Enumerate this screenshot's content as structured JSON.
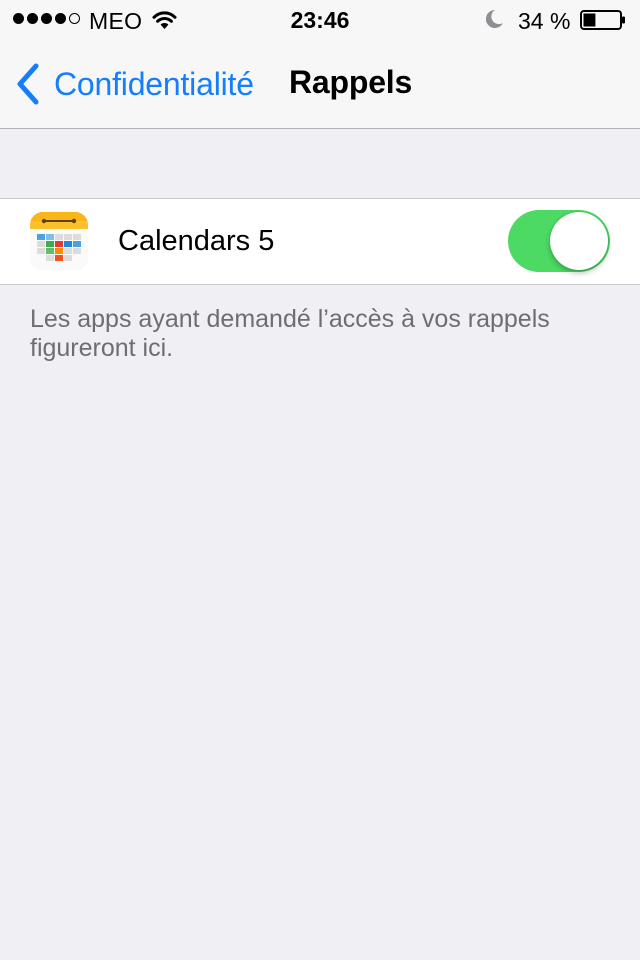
{
  "status_bar": {
    "signal_bars_filled": 4,
    "signal_bars_total": 5,
    "carrier": "MEO",
    "time": "23:46",
    "battery_percent_label": "34 %",
    "battery_level": 0.34,
    "icons": [
      "signal-dots",
      "wifi-icon",
      "moon-icon",
      "battery-icon"
    ]
  },
  "nav": {
    "back_label": "Confidentialité",
    "title": "Rappels",
    "accent_color": "#147efb"
  },
  "list": {
    "items": [
      {
        "label": "Calendars 5",
        "icon": "calendar-app-icon",
        "enabled": true
      }
    ],
    "footer": "Les apps ayant demandé l’accès à vos rappels figureront ici."
  },
  "colors": {
    "toggle_on": "#4cd964",
    "background": "#efeff4",
    "footer_text": "#6d6d72"
  }
}
